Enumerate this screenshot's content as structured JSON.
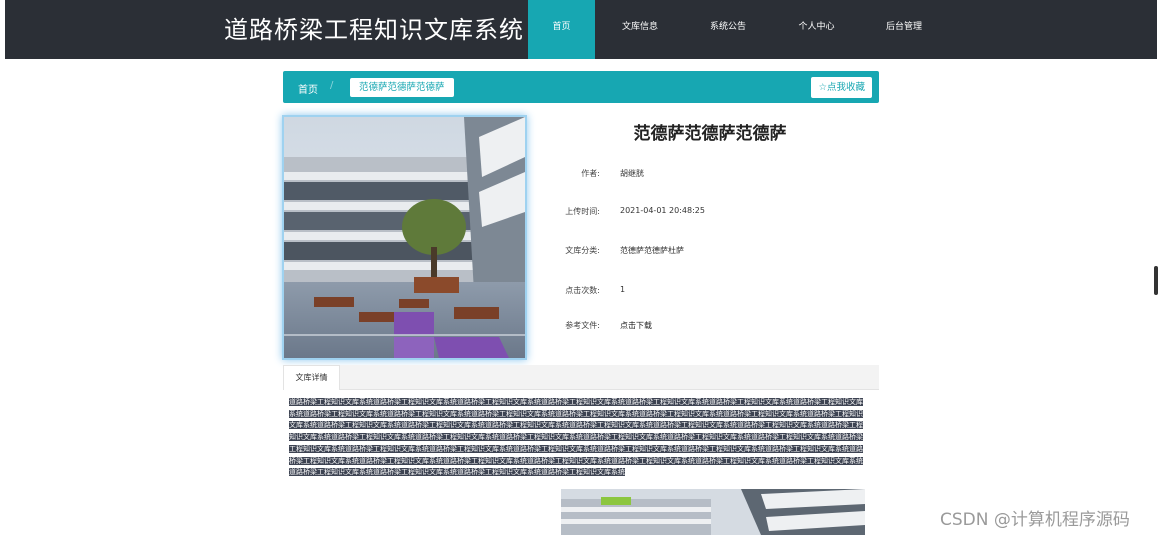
{
  "header": {
    "site_title": "道路桥梁工程知识文库系统",
    "nav": [
      {
        "label": "首页",
        "active": true
      },
      {
        "label": "文库信息",
        "active": false
      },
      {
        "label": "系统公告",
        "active": false
      },
      {
        "label": "个人中心",
        "active": false
      },
      {
        "label": "后台管理",
        "active": false
      }
    ]
  },
  "breadcrumb": {
    "home": "首页",
    "separator": "/",
    "current": "范德萨范德萨范德萨",
    "favorite_label": "☆点我收藏"
  },
  "doc": {
    "title": "范德萨范德萨范德萨",
    "fields": [
      {
        "label": "作者:",
        "value": "胡继胱"
      },
      {
        "label": "上传时间:",
        "value": "2021-04-01 20:48:25"
      },
      {
        "label": "文库分类:",
        "value": "范德萨范德萨杜萨"
      },
      {
        "label": "点击次数:",
        "value": "1"
      },
      {
        "label": "参考文件:",
        "value": "点击下载"
      }
    ]
  },
  "tabs": {
    "active_label": "文库详情"
  },
  "content": {
    "text": "道路桥梁工程知识文库系统道路桥梁工程知识文库系统道路桥梁工程知识文库系统道路桥梁工程知识文库系统道路桥梁工程知识文库系统道路桥梁工程知识文库系统道路桥梁工程知识文库系统道路桥梁工程知识文库系统道路桥梁工程知识文库系统道路桥梁工程知识文库系统道路桥梁工程知识文库系统道路桥梁工程知识文库系统道路桥梁工程知识文库系统道路桥梁工程知识文库系统道路桥梁工程知识文库系统道路桥梁工程知识文库系统道路桥梁工程知识文库系统道路桥梁工程知识文库系统道路桥梁工程知识文库系统道路桥梁工程知识文库系统道路桥梁工程知识文库系统道路桥梁工程知识文库系统道路桥梁工程知识文库系统道路桥梁工程知识文库系统道路桥梁工程知识文库系统道路桥梁工程知识文库系统道路桥梁工程知识文库系统道路桥梁工程知识文库系统道路桥梁工程知识文库系统道路桥梁工程知识文库系统道路桥梁工程知识文库系统道路桥梁工程知识文库系统道路桥梁工程知识文库系统道路桥梁工程知识文库系统道路桥梁工程知识文库系统道路桥梁工程知识文库系统道路桥梁工程知识文库系统道路桥梁工程知识文库系统道路桥梁工程知识文库系统道路桥梁工程知识文库系统道路桥梁工程知识文库系统道路桥梁工程知识文库系统道路桥梁工程知识文库系统道路桥梁工程知识文库系统道路桥梁工程知识文库系统"
  },
  "watermark": "CSDN @计算机程序源码",
  "colors": {
    "topbar": "#2b2f36",
    "accent": "#17a7b2",
    "text_highlight": "#3d4352"
  }
}
